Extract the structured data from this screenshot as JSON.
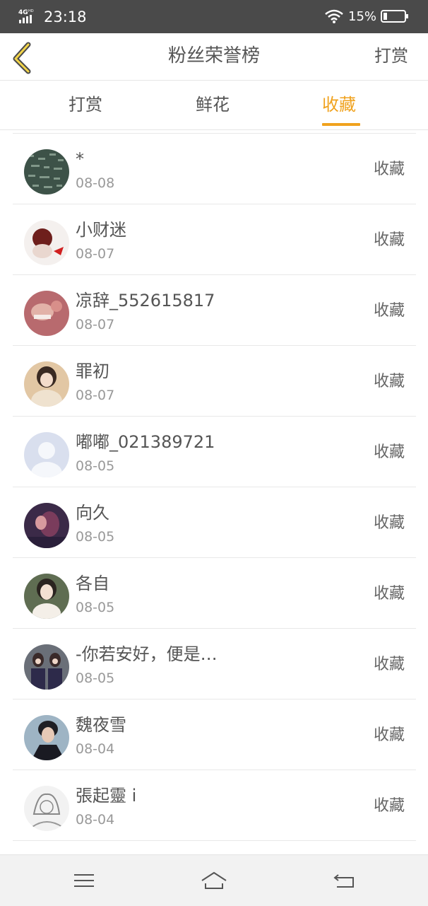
{
  "status_bar": {
    "network": "4G HD",
    "time": "23:18",
    "battery": "15%",
    "icons": [
      "signal-icon",
      "wifi-icon",
      "battery-icon"
    ]
  },
  "header": {
    "back_icon": "chevron-left-icon",
    "title": "粉丝荣誉榜",
    "action": "打赏"
  },
  "tabs": {
    "items": [
      {
        "label": "打赏"
      },
      {
        "label": "鲜花"
      },
      {
        "label": "收藏"
      }
    ],
    "active": "收藏"
  },
  "list": {
    "items": [
      {
        "name": "*",
        "date": "08-08",
        "action": "收藏"
      },
      {
        "name": "小财迷",
        "date": "08-07",
        "action": "收藏"
      },
      {
        "name": "凉辞_552615817",
        "date": "08-07",
        "action": "收藏"
      },
      {
        "name": "罪初",
        "date": "08-07",
        "action": "收藏"
      },
      {
        "name": "嘟嘟_021389721",
        "date": "08-05",
        "action": "收藏"
      },
      {
        "name": "向久",
        "date": "08-05",
        "action": "收藏"
      },
      {
        "name": "各自",
        "date": "08-05",
        "action": "收藏"
      },
      {
        "name": "-你若安好，便是…",
        "date": "08-05",
        "action": "收藏"
      },
      {
        "name": "魏夜雪",
        "date": "08-04",
        "action": "收藏"
      },
      {
        "name": "張起靈 i",
        "date": "08-04",
        "action": "收藏"
      }
    ]
  },
  "nav_bar": {
    "icons": [
      "menu-icon",
      "home-icon",
      "back-icon"
    ]
  },
  "colors": {
    "accent": "#f0a21e",
    "status_bar": "#4a4a4a"
  }
}
